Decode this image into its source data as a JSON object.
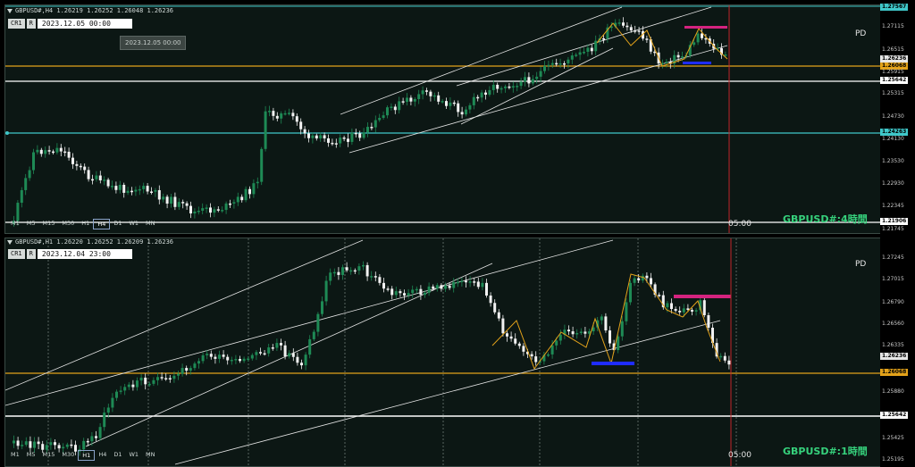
{
  "top": {
    "title": "GBPUSD#,H4  1.26219 1.26252 1.26048 1.26236",
    "cr_label": "CR1",
    "r_label": "R",
    "datetime": "2023.12.05 00:00",
    "tooltip": "2023.12.05 00:00",
    "pd": "PD",
    "symbol_label": "GBPUSD#:4時間",
    "time_label": "05:00",
    "timeframes": [
      "M1",
      "M5",
      "M15",
      "M30",
      "H1",
      "H4",
      "D1",
      "W1",
      "MN"
    ],
    "active_tf": "H4",
    "axis_ticks": [
      "1.27115",
      "1.26515",
      "1.25915",
      "1.25315",
      "1.24730",
      "1.24130",
      "1.23530",
      "1.22930",
      "1.22345",
      "1.21745"
    ],
    "price_tags": {
      "top": "1.27567",
      "current": "1.26236",
      "orange": "1.26068",
      "white1": "1.25642",
      "cyan": "1.24263",
      "white2": "1.21906"
    }
  },
  "bottom": {
    "title": "GBPUSD#,H1  1.26220 1.26252 1.26209 1.26236",
    "cr_label": "CR1",
    "r_label": "R",
    "datetime": "2023.12.04 23:00",
    "pd": "PD",
    "symbol_label": "GBPUSD#:1時間",
    "time_label": "05:00",
    "timeframes": [
      "M1",
      "M5",
      "M15",
      "M30",
      "H1",
      "H4",
      "D1",
      "W1",
      "MN"
    ],
    "active_tf": "H1",
    "axis_ticks": [
      "1.27245",
      "1.27015",
      "1.26790",
      "1.26560",
      "1.26335",
      "1.26105",
      "1.25880",
      "1.25650",
      "1.25425",
      "1.25195"
    ],
    "price_tags": {
      "current": "1.26236",
      "orange": "1.26068",
      "white": "1.25642"
    }
  },
  "colors": {
    "bg": "#0c1714",
    "bull": "#1e8a55",
    "bear": "#f2f2f2",
    "orange": "#e3a21a",
    "cyan": "#3fc7c9",
    "magenta": "#d4237f",
    "blue": "#1f2cff",
    "red": "#c0262a"
  }
}
